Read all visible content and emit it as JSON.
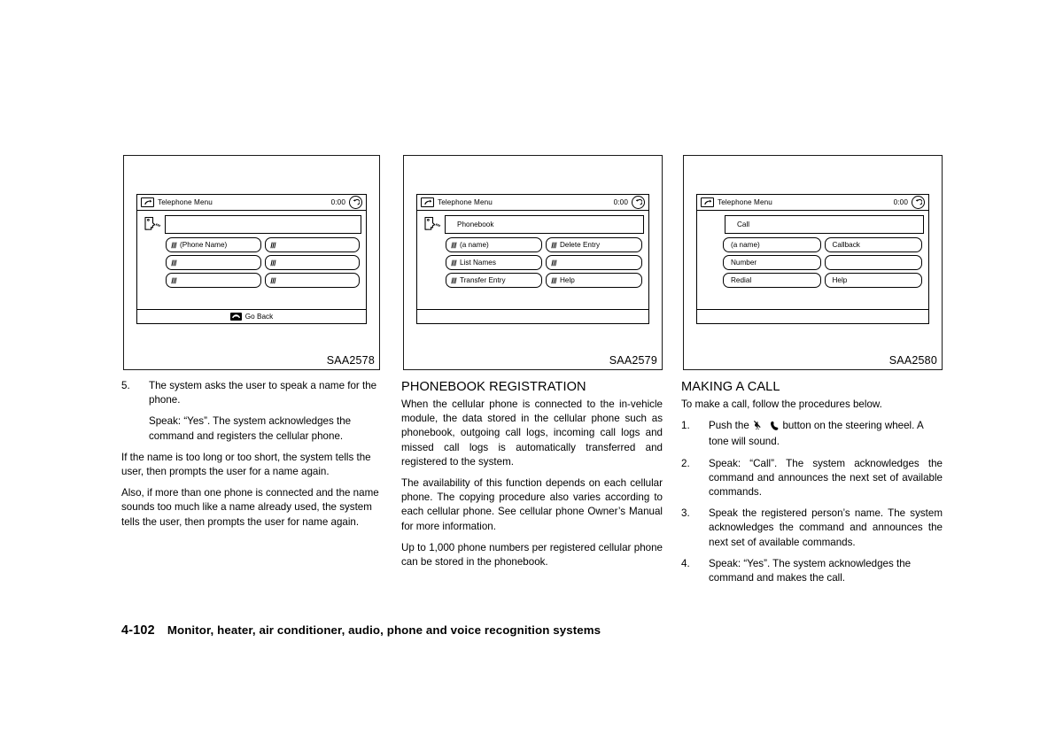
{
  "page": {
    "number": "4-102",
    "footer_title": "Monitor, heater, air conditioner, audio, phone and voice recognition systems"
  },
  "figures": [
    {
      "caption": "SAA2578",
      "screen": {
        "title": "Telephone Menu",
        "clock": "0:00",
        "title_icon": "phone-handset-icon",
        "back_icon": "back-arrow-icon",
        "has_face_icon": true,
        "prompt_value": "",
        "buttons": [
          {
            "label": "(Phone Name)",
            "wave": true
          },
          {
            "label": "",
            "wave": true
          },
          {
            "label": "",
            "wave": true
          },
          {
            "label": "",
            "wave": true
          },
          {
            "label": "",
            "wave": true
          },
          {
            "label": "",
            "wave": true
          }
        ],
        "footer_label": "Go Back",
        "footer_icon": "hangup-handset-icon",
        "has_footer_label": true
      }
    },
    {
      "caption": "SAA2579",
      "screen": {
        "title": "Telephone Menu",
        "clock": "0:00",
        "title_icon": "phone-handset-icon",
        "back_icon": "back-arrow-icon",
        "has_face_icon": true,
        "prompt_value": "Phonebook",
        "buttons": [
          {
            "label": "(a name)",
            "wave": true
          },
          {
            "label": "Delete Entry",
            "wave": true
          },
          {
            "label": "List Names",
            "wave": true
          },
          {
            "label": "",
            "wave": true
          },
          {
            "label": "Transfer Entry",
            "wave": true
          },
          {
            "label": "Help",
            "wave": true
          }
        ],
        "footer_label": "",
        "footer_icon": "",
        "has_footer_label": false
      }
    },
    {
      "caption": "SAA2580",
      "screen": {
        "title": "Telephone Menu",
        "clock": "0:00",
        "title_icon": "phone-handset-icon",
        "back_icon": "back-arrow-icon",
        "has_face_icon": false,
        "prompt_value": "Call",
        "buttons": [
          {
            "label": "(a name)",
            "wave": false
          },
          {
            "label": "Callback",
            "wave": false
          },
          {
            "label": "Number",
            "wave": false
          },
          {
            "label": "",
            "wave": false
          },
          {
            "label": "Redial",
            "wave": false
          },
          {
            "label": "Help",
            "wave": false
          }
        ],
        "footer_label": "",
        "footer_icon": "",
        "has_footer_label": false
      }
    }
  ],
  "col1": {
    "step5_num": "5.",
    "step5_text": "The system asks the user to speak a name for the phone.",
    "step5_sub": "Speak: “Yes”. The system acknowledges the command and registers the cellular phone.",
    "para1": "If the name is too long or too short, the system tells the user, then prompts the user for a name again.",
    "para2": "Also, if more than one phone is connected and the name sounds too much like a name already used, the system tells the user, then prompts the user for name again."
  },
  "col2": {
    "heading": "PHONEBOOK REGISTRATION",
    "para1": "When the cellular phone is connected to the in-vehicle module, the data stored in the cellular phone such as phonebook, outgoing call logs, incoming call logs and missed call logs is automatically transferred and registered to the system.",
    "para2": "The availability of this function depends on each cellular phone. The copying procedure also varies according to each cellular phone. See cellular phone Owner’s Manual for more information.",
    "para3": "Up to 1,000 phone numbers per registered cellular phone can be stored in the phonebook."
  },
  "col3": {
    "heading": "MAKING A CALL",
    "intro": "To make a call, follow the procedures below.",
    "steps": [
      {
        "num": "1.",
        "text_before": "Push the",
        "icons": [
          "voice-command-icon",
          "phone-handset-icon"
        ],
        "text_after": "button on the steering wheel. A tone will sound."
      },
      {
        "num": "2.",
        "text": "Speak: “Call”. The system acknowledges the command and announces the next set of available commands."
      },
      {
        "num": "3.",
        "text": "Speak the registered person’s name. The system acknowledges the command and announces the next set of available commands."
      },
      {
        "num": "4.",
        "text": "Speak: “Yes”. The system acknowledges the command and makes the call."
      }
    ]
  }
}
